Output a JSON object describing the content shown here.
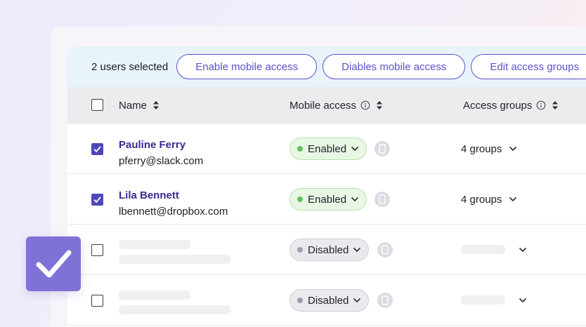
{
  "toolbar": {
    "selected_text": "2 users selected",
    "enable_label": "Enable mobile access",
    "disable_label": "Diables mobile access",
    "edit_label": "Edit access groups"
  },
  "columns": {
    "name": "Name",
    "mobile_access": "Mobile access",
    "access_groups": "Access groups"
  },
  "rows": [
    {
      "checked": true,
      "name": "Pauline Ferry",
      "email": "pferry@slack.com",
      "status": "Enabled",
      "groups": "4 groups"
    },
    {
      "checked": true,
      "name": "Lila Bennett",
      "email": "lbennett@dropbox.com",
      "status": "Enabled",
      "groups": "4 groups"
    },
    {
      "checked": false,
      "name": "",
      "email": "",
      "status": "Disabled",
      "groups": ""
    },
    {
      "checked": false,
      "name": "",
      "email": "",
      "status": "Disabled",
      "groups": ""
    }
  ],
  "colors": {
    "accent": "#5b52c9",
    "checkbox_checked": "#4e47b8",
    "enabled_dot": "#5cc45a",
    "disabled_dot": "#9aa0ab",
    "big_check": "#7e72d6"
  },
  "icons": {
    "sort": "sort-icon",
    "info": "info-icon",
    "chevron": "chevron-down-icon",
    "device": "mobile-device-icon",
    "check": "check-icon"
  }
}
